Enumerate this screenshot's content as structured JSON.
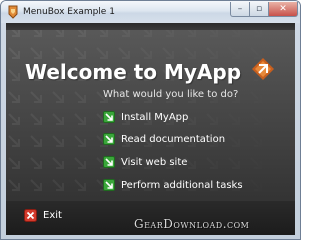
{
  "window": {
    "title": "MenuBox Example 1",
    "buttons": {
      "minimize_glyph": "–",
      "maximize_glyph": "▫",
      "close_glyph": "✕"
    }
  },
  "main": {
    "heading": "Welcome to MyApp",
    "prompt": "What would you like to do?",
    "menu_items": [
      {
        "label": "Install MyApp",
        "icon": "green-arrow-icon"
      },
      {
        "label": "Read documentation",
        "icon": "green-arrow-icon"
      },
      {
        "label": "Visit web site",
        "icon": "green-arrow-icon"
      },
      {
        "label": "Perform additional tasks",
        "icon": "green-arrow-icon"
      }
    ]
  },
  "footer": {
    "exit_label": "Exit",
    "exit_icon": "red-x-icon"
  },
  "watermark": "GearDownload.com",
  "colors": {
    "panel_dark": "#2c2c2c",
    "panel_light": "#5a5a5a",
    "arrow_green": "#3aa63a",
    "exit_red": "#d33a2c",
    "logo_orange": "#e0782a"
  }
}
